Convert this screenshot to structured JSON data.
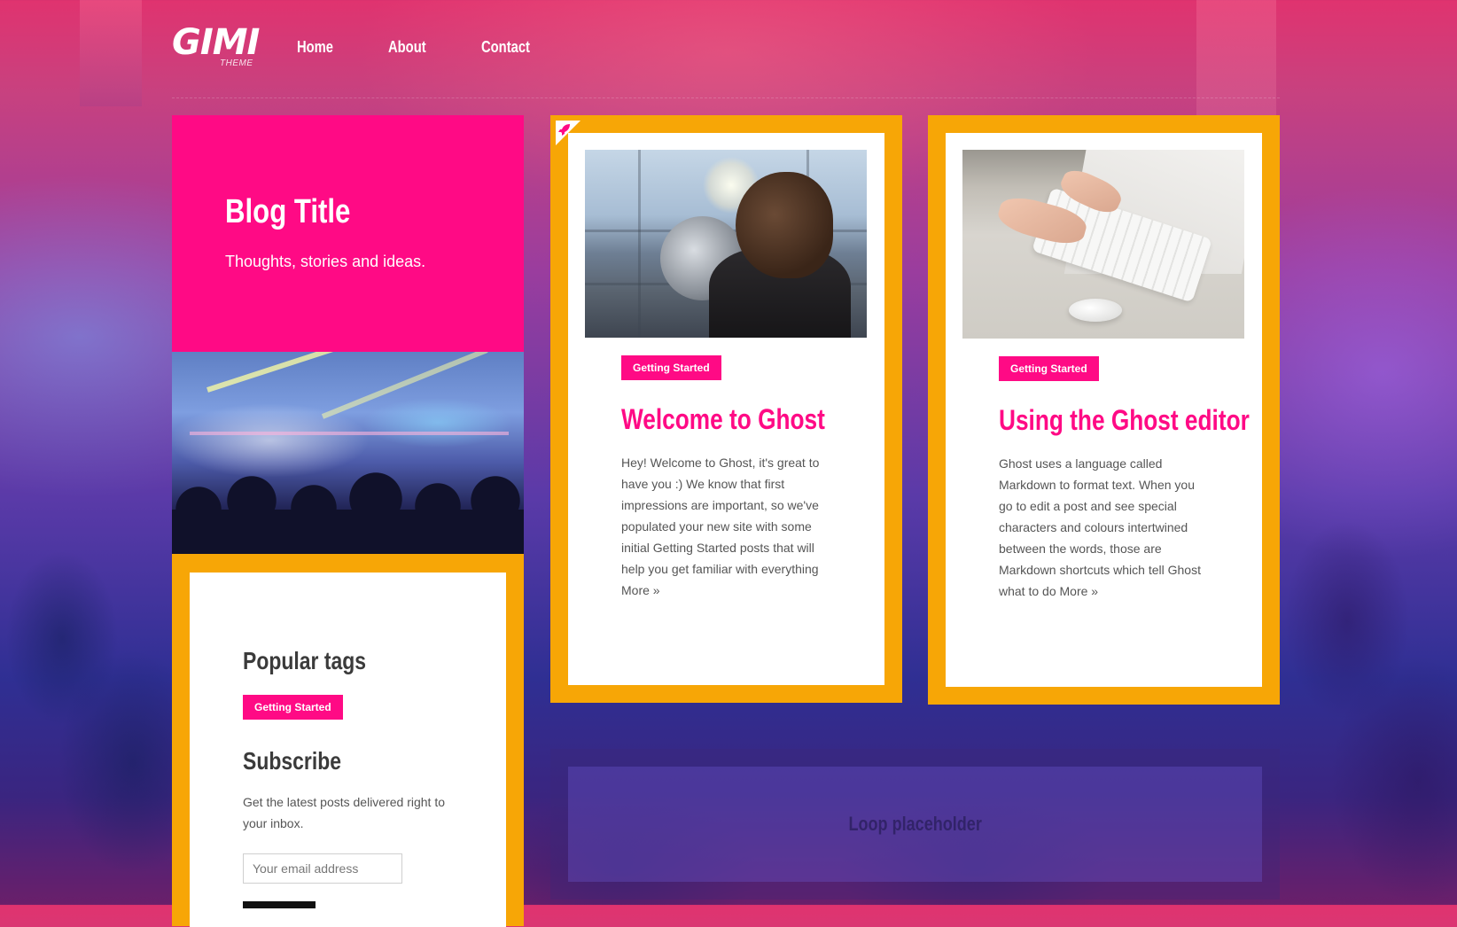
{
  "header": {
    "logo": {
      "main": "GIMI",
      "sub": "THEME"
    },
    "nav": [
      {
        "label": "Home"
      },
      {
        "label": "About"
      },
      {
        "label": "Contact"
      }
    ]
  },
  "hero": {
    "title": "Blog Title",
    "description": "Thoughts, stories and ideas."
  },
  "sidebar": {
    "popular_tags_title": "Popular tags",
    "tags": [
      "Getting Started"
    ],
    "subscribe_title": "Subscribe",
    "subscribe_text": "Get the latest posts delivered right to your inbox.",
    "email_placeholder": "Your email address"
  },
  "posts": [
    {
      "featured": true,
      "tag": "Getting Started",
      "title": "Welcome to Ghost",
      "excerpt": "Hey! Welcome to Ghost, it's great to have you :) We know that first impressions are important, so we've populated your new site with some initial Getting Started posts that will help you get familiar with everything",
      "more": "More »",
      "image_icon": "observation-deck-binocular-image"
    },
    {
      "featured": false,
      "tag": "Getting Started",
      "title": "Using the Ghost editor",
      "excerpt": "Ghost uses a language called Markdown to format text. When you go to edit a post and see special characters and colours intertwined between the words, those are Markdown shortcuts which tell Ghost what to do",
      "more": "More »",
      "image_icon": "desk-keyboard-typing-image"
    }
  ],
  "loop": {
    "label": "Loop placeholder"
  },
  "colors": {
    "accent": "#ff0a85",
    "frame": "#f7a606",
    "text": "#555555",
    "heading": "#3b3b3b"
  }
}
